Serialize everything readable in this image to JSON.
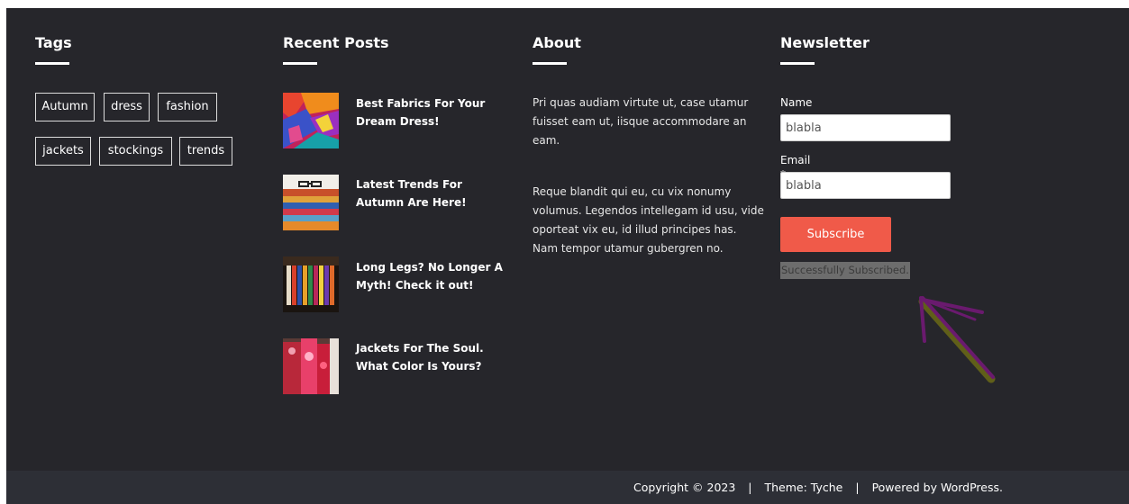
{
  "tags": {
    "title": "Tags",
    "items": [
      "Autumn",
      "dress",
      "fashion",
      "jackets",
      "stockings",
      "trends"
    ]
  },
  "recent_posts": {
    "title": "Recent Posts",
    "items": [
      {
        "title": "Best Fabrics For Your Dream Dress!",
        "thumb": "colorful-fabrics-thumbnail"
      },
      {
        "title": "Latest Trends For Autumn Are Here!",
        "thumb": "folded-sweaters-glasses-thumbnail"
      },
      {
        "title": "Long Legs? No Longer A Myth! Check it out!",
        "thumb": "colored-stockings-thumbnail"
      },
      {
        "title": "Jackets For The Soul. What Color Is Yours?",
        "thumb": "jackets-rack-thumbnail"
      }
    ]
  },
  "about": {
    "title": "About",
    "paragraphs": [
      "Pri quas audiam virtute ut, case utamur fuisset eam ut, iisque accommodare an eam.",
      "Reque blandit qui eu, cu vix nonumy volumus. Legendos intellegam id usu, vide oporteat vix eu, id illud principes has. Nam tempor utamur gubergren no."
    ]
  },
  "newsletter": {
    "title": "Newsletter",
    "name_label": "Name",
    "name_value": "blabla",
    "email_label": "Email *",
    "email_value": "blabla",
    "subscribe_label": "Subscribe",
    "success_message": "Successfully Subscribed."
  },
  "footer": {
    "copyright": "Copyright © 2023",
    "separator": "|",
    "theme": "Theme: Tyche",
    "powered": "Powered by WordPress."
  },
  "colors": {
    "widgets_bg": "#26262b",
    "bottom_bar_bg": "#2d2f36",
    "accent": "#f05a49",
    "annotation_arrow": "#6a1a6e",
    "annotation_highlight": "#6b6a16"
  }
}
